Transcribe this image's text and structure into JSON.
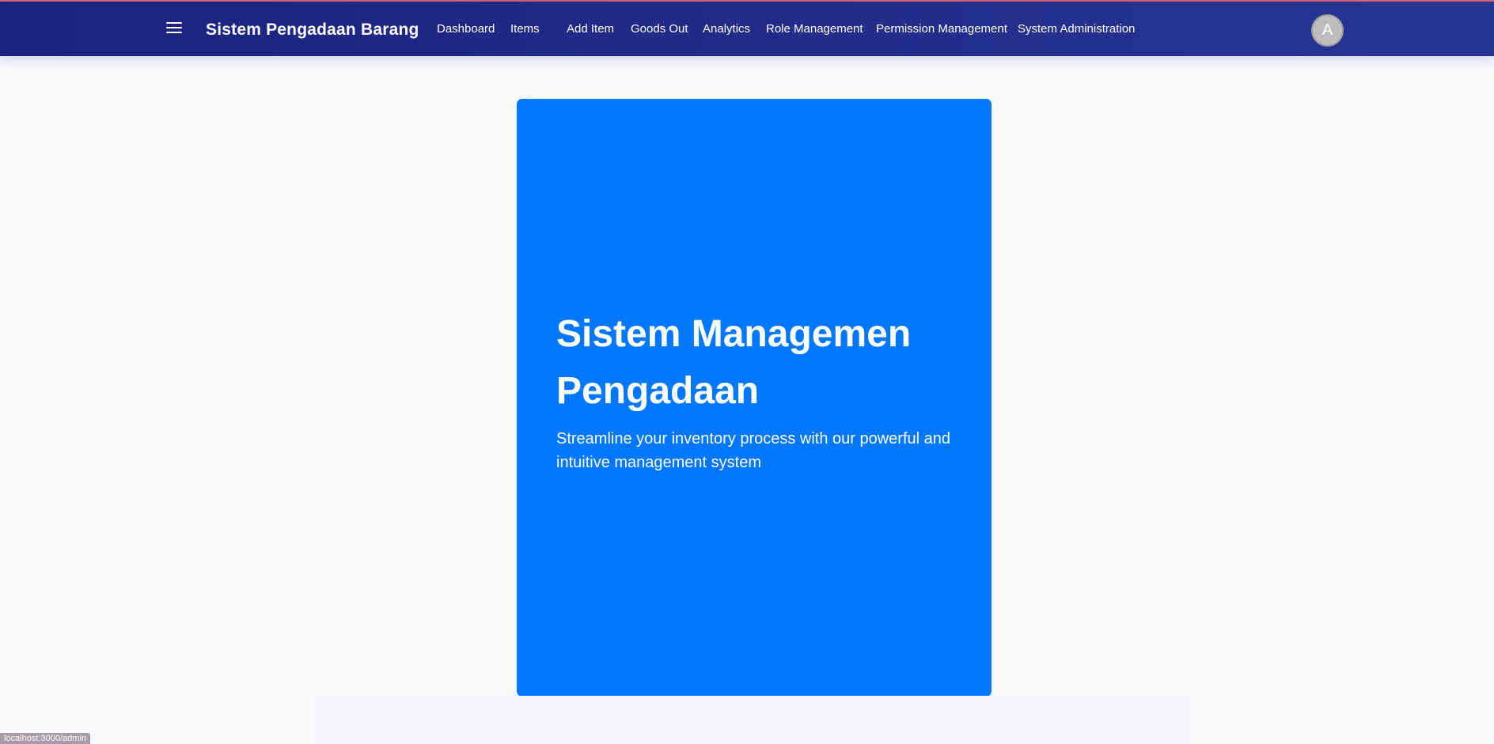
{
  "header": {
    "brand": "Sistem Pengadaan Barang",
    "menu_icon": "hamburger-menu-icon",
    "avatar_initial": "A",
    "nav": {
      "dashboard": "Dashboard",
      "items": "Items",
      "add_item": "Add Item",
      "goods_out": "Goods Out",
      "analytics": "Analytics",
      "role_management": "Role Management",
      "permission_management": "Permission Management",
      "system_administration": "System Administration"
    },
    "colors": {
      "gradient_start": "#1a237e",
      "gradient_end": "#283593",
      "accent_line": "#e0607e"
    }
  },
  "hero": {
    "title": "Sistem Managemen Pengadaan",
    "subtitle": "Streamline your inventory process with our powerful and intuitive management system",
    "background": "#0077ff"
  },
  "status_bar": {
    "url": "localhost:3000/admin"
  }
}
